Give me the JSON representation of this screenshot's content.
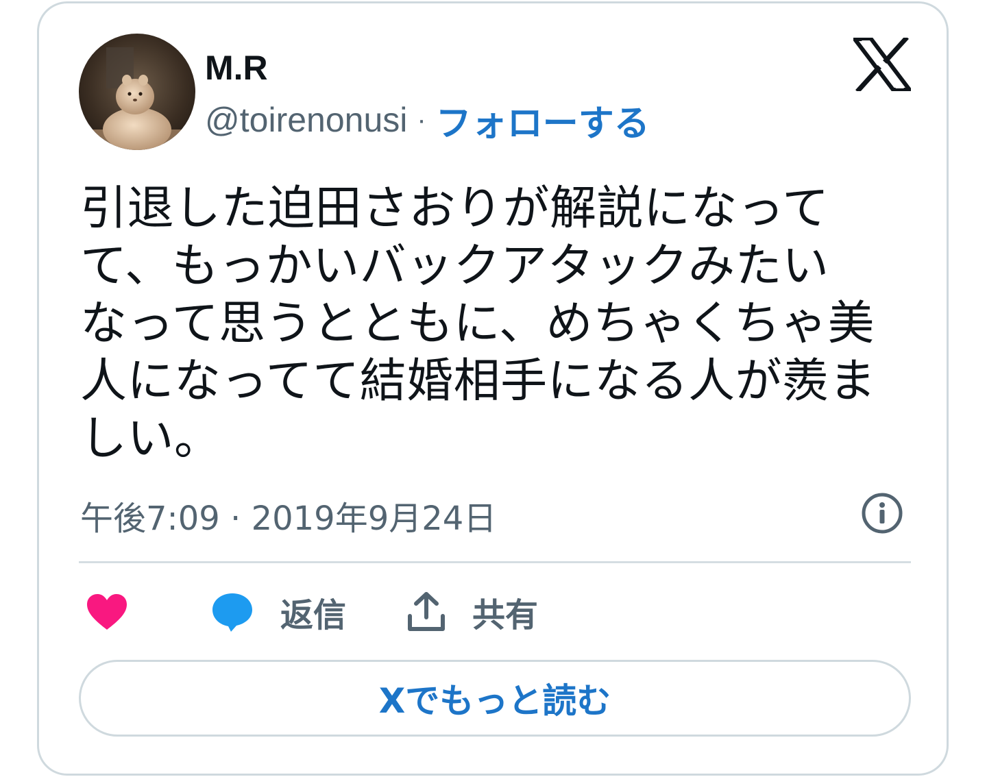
{
  "author": {
    "display_name": "M.R",
    "handle": "@toirenonusi",
    "separator": "·",
    "follow_label": "フォローする"
  },
  "tweet": {
    "text_lines": [
      "引退した迫田さおりが解説になって",
      "て、もっかいバックアタックみたい",
      "なって思うとともに、めちゃくちゃ美",
      "人になってて結婚相手になる人が羨ま",
      "しい。"
    ],
    "timestamp": "午後7:09 · 2019年9月24日"
  },
  "actions": {
    "like_icon": "heart-icon",
    "reply_icon": "speech-bubble-icon",
    "reply_label": "返信",
    "share_icon": "share-upload-icon",
    "share_label": "共有"
  },
  "read_more_label": "Xでもっと読む",
  "colors": {
    "accent": "#1d75c8",
    "like": "#f91880",
    "reply": "#1d9bf0",
    "muted_text": "#536471",
    "border": "#cfd9de"
  }
}
